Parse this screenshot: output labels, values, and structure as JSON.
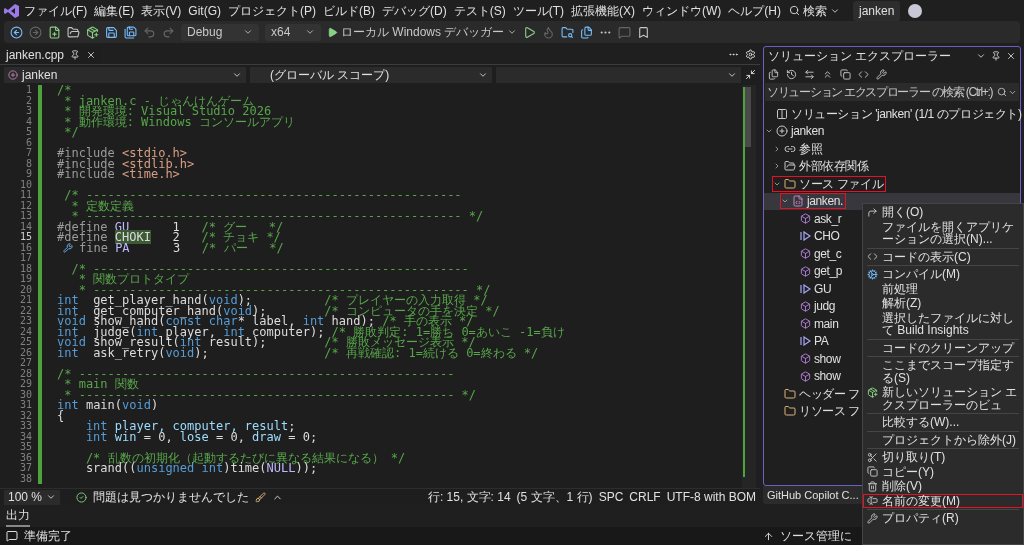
{
  "menu_bar": {
    "items": [
      "ファイル(F)",
      "編集(E)",
      "表示(V)",
      "Git(G)",
      "プロジェクト(P)",
      "ビルド(B)",
      "デバッグ(D)",
      "テスト(S)",
      "ツール(T)",
      "拡張機能(X)",
      "ウィンドウ(W)",
      "ヘルプ(H)"
    ],
    "search": "検索",
    "title": "janken"
  },
  "toolbar": {
    "configuration": "Debug",
    "platform": "x64",
    "debugger": "ローカル Windows デバッガー"
  },
  "editor": {
    "tabs": [
      {
        "label": "janken.cpp",
        "selected": true
      }
    ],
    "nav": {
      "project": "janken",
      "scope": "(グローバル スコープ)"
    },
    "lines": [
      {
        "n": "1",
        "current": false,
        "segs": [
          {
            "kind": "comment",
            "text": "/*"
          }
        ]
      },
      {
        "n": "2",
        "current": false,
        "segs": [
          {
            "kind": "comment",
            "text": " * janken.c - じゃんけんゲーム"
          }
        ]
      },
      {
        "n": "3",
        "current": false,
        "segs": [
          {
            "kind": "comment",
            "text": " * 開発環境: Visual Studio 2026"
          }
        ]
      },
      {
        "n": "4",
        "current": false,
        "segs": [
          {
            "kind": "comment",
            "text": " * 動作環境: Windows コンソールアプリ"
          }
        ]
      },
      {
        "n": "5",
        "current": false,
        "segs": [
          {
            "kind": "comment",
            "text": " */"
          }
        ]
      },
      {
        "n": "6",
        "current": false
      },
      {
        "n": "7",
        "current": false,
        "segs": [
          {
            "kind": "preproc",
            "text": "#include "
          },
          {
            "kind": "header",
            "text": "<stdio.h>"
          }
        ]
      },
      {
        "n": "8",
        "current": false,
        "segs": [
          {
            "kind": "preproc",
            "text": "#include "
          },
          {
            "kind": "header",
            "text": "<stdlib.h>"
          }
        ]
      },
      {
        "n": "9",
        "current": false,
        "segs": [
          {
            "kind": "preproc",
            "text": "#include "
          },
          {
            "kind": "header",
            "text": "<time.h>"
          }
        ]
      },
      {
        "n": "10",
        "current": false
      },
      {
        "n": "11",
        "current": false,
        "segs": [
          {
            "kind": "comment",
            "text": " /* ----------------------------------------------------"
          }
        ]
      },
      {
        "n": "12",
        "current": false,
        "segs": [
          {
            "kind": "comment",
            "text": "  * 定数定義"
          }
        ]
      },
      {
        "n": "13",
        "current": false,
        "segs": [
          {
            "kind": "comment",
            "text": "  * ---------------------------------------------------- */"
          }
        ]
      },
      {
        "n": "14",
        "current": false,
        "segs": [
          {
            "kind": "preproc",
            "text": "#define "
          },
          {
            "kind": "macro",
            "text": "GU"
          },
          {
            "kind": "text",
            "text": "      1   "
          },
          {
            "kind": "comment",
            "text": "/* グー   */"
          }
        ]
      },
      {
        "n": "15",
        "current": true,
        "segs": [
          {
            "kind": "preproc",
            "text": "#define "
          },
          {
            "kind": "highlight",
            "text": "CHOKI"
          },
          {
            "kind": "text",
            "text": "   2   "
          },
          {
            "kind": "comment",
            "text": "/* チョキ */"
          }
        ]
      },
      {
        "n": "16",
        "current": false,
        "quick_action": true,
        "segs": [
          {
            "kind": "preproc",
            "text": "fine "
          },
          {
            "kind": "macro",
            "text": "PA"
          },
          {
            "kind": "text",
            "text": "      3   "
          },
          {
            "kind": "comment",
            "text": "/* パー   */"
          }
        ]
      },
      {
        "n": "17",
        "current": false
      },
      {
        "n": "18",
        "current": false,
        "segs": [
          {
            "kind": "comment",
            "text": "  /* ----------------------------------------------------"
          }
        ]
      },
      {
        "n": "19",
        "current": false,
        "segs": [
          {
            "kind": "comment",
            "text": "   * 関数プロトタイプ"
          }
        ]
      },
      {
        "n": "20",
        "current": false,
        "segs": [
          {
            "kind": "comment",
            "text": "   * ---------------------------------------------------- */"
          }
        ]
      },
      {
        "n": "21",
        "current": false,
        "segs": [
          {
            "kind": "keyword",
            "text": "int"
          },
          {
            "kind": "text",
            "text": "  get_player_hand("
          },
          {
            "kind": "keyword",
            "text": "void"
          },
          {
            "kind": "text",
            "text": ");          "
          },
          {
            "kind": "comment",
            "text": "/* プレイヤーの入力取得 */"
          }
        ]
      },
      {
        "n": "22",
        "current": false,
        "segs": [
          {
            "kind": "keyword",
            "text": "int"
          },
          {
            "kind": "text",
            "text": "  get_computer_hand("
          },
          {
            "kind": "keyword",
            "text": "void"
          },
          {
            "kind": "text",
            "text": ");        "
          },
          {
            "kind": "comment",
            "text": "/* コンピュータの手を決定 */"
          }
        ]
      },
      {
        "n": "23",
        "current": false,
        "segs": [
          {
            "kind": "keyword",
            "text": "void"
          },
          {
            "kind": "text",
            "text": " show_hand("
          },
          {
            "kind": "keyword",
            "text": "const char"
          },
          {
            "kind": "text",
            "text": "* label, "
          },
          {
            "kind": "keyword",
            "text": "int"
          },
          {
            "kind": "text",
            "text": " hand); "
          },
          {
            "kind": "comment",
            "text": "/* 手の表示 */"
          }
        ]
      },
      {
        "n": "24",
        "current": false,
        "segs": [
          {
            "kind": "keyword",
            "text": "int"
          },
          {
            "kind": "text",
            "text": "  judge("
          },
          {
            "kind": "keyword",
            "text": "int"
          },
          {
            "kind": "text",
            "text": " player, "
          },
          {
            "kind": "keyword",
            "text": "int"
          },
          {
            "kind": "text",
            "text": " computer); "
          },
          {
            "kind": "comment",
            "text": "/* 勝敗判定: 1=勝ち 0=あいこ -1=負け"
          }
        ]
      },
      {
        "n": "25",
        "current": false,
        "segs": [
          {
            "kind": "keyword",
            "text": "void"
          },
          {
            "kind": "text",
            "text": " show_result("
          },
          {
            "kind": "keyword",
            "text": "int"
          },
          {
            "kind": "text",
            "text": " result);        "
          },
          {
            "kind": "comment",
            "text": "/* 勝敗メッセージ表示 */"
          }
        ]
      },
      {
        "n": "26",
        "current": false,
        "segs": [
          {
            "kind": "keyword",
            "text": "int"
          },
          {
            "kind": "text",
            "text": "  ask_retry("
          },
          {
            "kind": "keyword",
            "text": "void"
          },
          {
            "kind": "text",
            "text": ");                "
          },
          {
            "kind": "comment",
            "text": "/* 再戦確認: 1=続ける 0=終わる */"
          }
        ]
      },
      {
        "n": "27",
        "current": false
      },
      {
        "n": "28",
        "current": false,
        "segs": [
          {
            "kind": "comment",
            "text": "/* ----------------------------------------------------"
          }
        ]
      },
      {
        "n": "29",
        "current": false,
        "segs": [
          {
            "kind": "comment",
            "text": " * main 関数"
          }
        ]
      },
      {
        "n": "30",
        "current": false,
        "segs": [
          {
            "kind": "comment",
            "text": " * ---------------------------------------------------- */"
          }
        ]
      },
      {
        "n": "31",
        "current": false,
        "segs": [
          {
            "kind": "keyword",
            "text": "int"
          },
          {
            "kind": "text",
            "text": " main("
          },
          {
            "kind": "keyword",
            "text": "void"
          },
          {
            "kind": "text",
            "text": ")"
          }
        ]
      },
      {
        "n": "32",
        "current": false,
        "segs": [
          {
            "kind": "text",
            "text": "{"
          }
        ]
      },
      {
        "n": "33",
        "current": false,
        "segs": [
          {
            "kind": "keyword",
            "text": "    int"
          },
          {
            "kind": "ident",
            "text": " player, computer, result"
          },
          {
            "kind": "text",
            "text": ";"
          }
        ]
      },
      {
        "n": "34",
        "current": false,
        "segs": [
          {
            "kind": "keyword",
            "text": "    int"
          },
          {
            "kind": "ident",
            "text": " win"
          },
          {
            "kind": "text",
            "text": " = 0, "
          },
          {
            "kind": "ident",
            "text": "lose"
          },
          {
            "kind": "text",
            "text": " = 0, "
          },
          {
            "kind": "ident",
            "text": "draw"
          },
          {
            "kind": "text",
            "text": " = 0;"
          }
        ]
      },
      {
        "n": "35",
        "current": false
      },
      {
        "n": "36",
        "current": false,
        "segs": [
          {
            "kind": "comment",
            "text": "    /* 乱数の初期化（起動するたびに異なる結果になる） */"
          }
        ]
      },
      {
        "n": "37",
        "current": false,
        "segs": [
          {
            "kind": "text",
            "text": "    srand(("
          },
          {
            "kind": "keyword",
            "text": "unsigned int"
          },
          {
            "kind": "text",
            "text": ")time("
          },
          {
            "kind": "macro",
            "text": "NULL"
          },
          {
            "kind": "text",
            "text": "));"
          }
        ]
      },
      {
        "n": "38",
        "current": false
      }
    ],
    "status": {
      "zoom": "100 %",
      "issues": "問題は見つかりませんでした",
      "position": "行: 15, 文字: 14",
      "selection": "(5 文字、1 行)",
      "indent": "SPC",
      "line_ending": "CRLF",
      "encoding": "UTF-8 with BOM"
    }
  },
  "solution_explorer": {
    "title": "ソリューション エクスプローラー",
    "search": {
      "placeholder": "ソリューション エクスプローラー の検索 (Ctrl+:)"
    },
    "tree": [
      {
        "label": "ソリューション 'janken' (1/1 のプロジェクト)",
        "kind": "solution",
        "selected": false,
        "outlined": false
      },
      {
        "label": "janken",
        "kind": "project",
        "expanded": true,
        "selected": false,
        "outlined": false,
        "children": [
          {
            "label": "参照",
            "kind": "references",
            "expanded": false,
            "selected": false,
            "outlined": false
          },
          {
            "label": "外部依存関係",
            "kind": "dependencies",
            "expanded": false,
            "selected": false,
            "outlined": false
          },
          {
            "label": "ソース ファイル",
            "kind": "folder",
            "expanded": true,
            "selected": false,
            "outlined": true,
            "children": [
              {
                "label": "janken.",
                "kind": "file",
                "expanded": true,
                "selected": true,
                "outlined": true,
                "children": [
                  {
                    "label": "ask_r",
                    "kind": "function",
                    "selected": false,
                    "outlined": false
                  },
                  {
                    "label": "CHO",
                    "kind": "macro",
                    "selected": false,
                    "outlined": false
                  },
                  {
                    "label": "get_c",
                    "kind": "function",
                    "selected": false,
                    "outlined": false
                  },
                  {
                    "label": "get_p",
                    "kind": "function",
                    "selected": false,
                    "outlined": false
                  },
                  {
                    "label": "GU",
                    "kind": "macro",
                    "selected": false,
                    "outlined": false
                  },
                  {
                    "label": "judg",
                    "kind": "function",
                    "selected": false,
                    "outlined": false
                  },
                  {
                    "label": "main",
                    "kind": "function",
                    "selected": false,
                    "outlined": false
                  },
                  {
                    "label": "PA",
                    "kind": "macro",
                    "selected": false,
                    "outlined": false
                  },
                  {
                    "label": "show",
                    "kind": "function",
                    "selected": false,
                    "outlined": false
                  },
                  {
                    "label": "show",
                    "kind": "function",
                    "selected": false,
                    "outlined": false
                  }
                ]
              }
            ]
          },
          {
            "label": "ヘッダー フ",
            "kind": "folder",
            "selected": false,
            "outlined": false
          },
          {
            "label": "リソース フ",
            "kind": "folder",
            "selected": false,
            "outlined": false
          }
        ]
      }
    ],
    "bottom_tab": "GitHub Copilot C..."
  },
  "context_menu": {
    "items": [
      {
        "kind": "item",
        "label": "開く(O)",
        "outlined": false
      },
      {
        "kind": "item",
        "label": "ファイルを開くアプリケーションの選択(N)...",
        "outlined": false
      },
      {
        "kind": "separator"
      },
      {
        "kind": "item",
        "label": "コードの表示(C)",
        "outlined": false
      },
      {
        "kind": "separator"
      },
      {
        "kind": "item",
        "label": "コンパイル(M)",
        "outlined": false
      },
      {
        "kind": "item",
        "label": "前処理",
        "outlined": false
      },
      {
        "kind": "item",
        "label": "解析(Z)",
        "outlined": false
      },
      {
        "kind": "item",
        "label": "選択したファイルに対して Build Insights",
        "outlined": false
      },
      {
        "kind": "separator"
      },
      {
        "kind": "item",
        "label": "コードのクリーンアップ",
        "outlined": false
      },
      {
        "kind": "separator"
      },
      {
        "kind": "item",
        "label": "ここまでスコープ指定する(S)",
        "outlined": false
      },
      {
        "kind": "item",
        "label": "新しいソリューション エクスプローラーのビュ",
        "outlined": false
      },
      {
        "kind": "separator"
      },
      {
        "kind": "item",
        "label": "比較する(W)...",
        "outlined": false
      },
      {
        "kind": "separator"
      },
      {
        "kind": "item",
        "label": "プロジェクトから除外(J)",
        "outlined": false
      },
      {
        "kind": "separator"
      },
      {
        "kind": "item",
        "label": "切り取り(T)",
        "outlined": false
      },
      {
        "kind": "item",
        "label": "コピー(Y)",
        "outlined": false
      },
      {
        "kind": "item",
        "label": "削除(V)",
        "outlined": false
      },
      {
        "kind": "item",
        "label": "名前の変更(M)",
        "outlined": true
      },
      {
        "kind": "separator"
      },
      {
        "kind": "item",
        "label": "プロパティ(R)",
        "outlined": false
      }
    ]
  },
  "output_panel": {
    "tab": "出力"
  },
  "status_bar": {
    "message": "準備完了",
    "source_control": "ソース管理に"
  }
}
